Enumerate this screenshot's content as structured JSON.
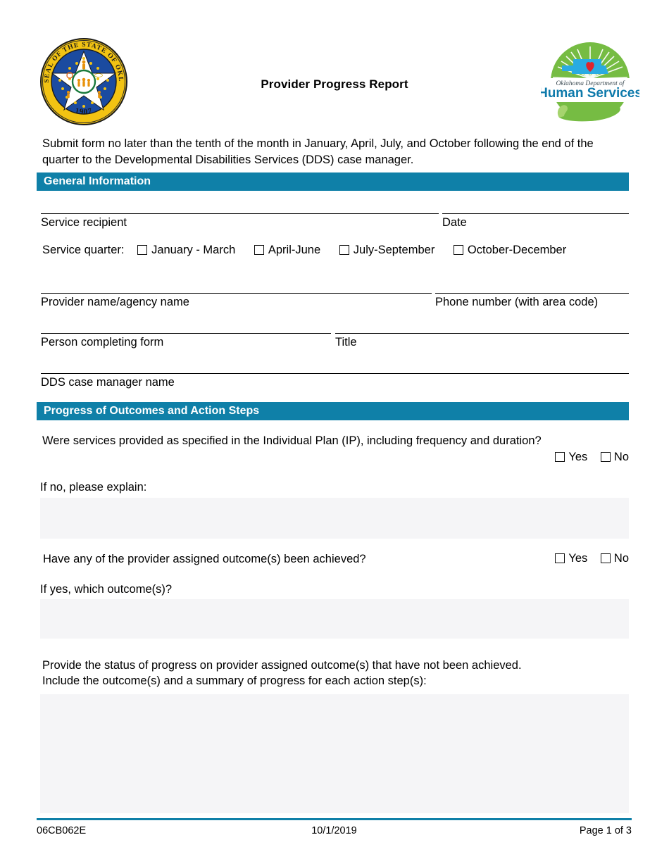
{
  "header": {
    "title": "Provider Progress Report",
    "seal_icon": "oklahoma-state-seal-icon",
    "seal_text_top": "GREAT SEAL OF THE STATE OF OKLAHOMA",
    "seal_year": "1907",
    "agency_logo_icon": "oklahoma-dhs-logo-icon",
    "agency_line1": "Oklahoma Department of",
    "agency_line2": "Human Services"
  },
  "instruction": "Submit form no later than the tenth of the month in January, April, July, and October following the end of the quarter to the Developmental Disabilities Services (DDS) case manager.",
  "sections": {
    "general": "General Information",
    "progress": "Progress of Outcomes and Action Steps"
  },
  "fields": {
    "service_recipient": "Service recipient",
    "date": "Date",
    "service_quarter": "Service quarter:",
    "provider_name": "Provider name/agency name",
    "phone_number": "Phone number (with area code)",
    "person_completing": "Person completing form",
    "title": "Title",
    "dds_case_manager": "DDS case manager name"
  },
  "quarters": [
    {
      "label": "January - March",
      "checked": false
    },
    {
      "label": "April-June",
      "checked": false
    },
    {
      "label": "July-September",
      "checked": false
    },
    {
      "label": "October-December",
      "checked": false
    }
  ],
  "questions": {
    "q1": "Were services provided as specified in the Individual Plan (IP), including frequency and duration?",
    "q1_yes": "Yes",
    "q1_no": "No",
    "q1_explain": "If no, please explain:",
    "q1_explain_value": "",
    "q2": "Have any of the provider assigned outcome(s) been achieved?",
    "q2_yes": "Yes",
    "q2_no": "No",
    "q2_which": "If yes, which outcome(s)?",
    "q2_which_value": "",
    "q3_line1": "Provide the status of progress on provider assigned outcome(s) that have not been achieved.",
    "q3_line2": "Include the outcome(s) and a summary of progress for each action step(s):",
    "q3_value": ""
  },
  "footer": {
    "form_number": "06CB062E",
    "revision_date": "10/1/2019",
    "page": "Page 1 of 3"
  },
  "colors": {
    "accent": "#0f80a8",
    "field_fill": "#f5f5f7"
  }
}
